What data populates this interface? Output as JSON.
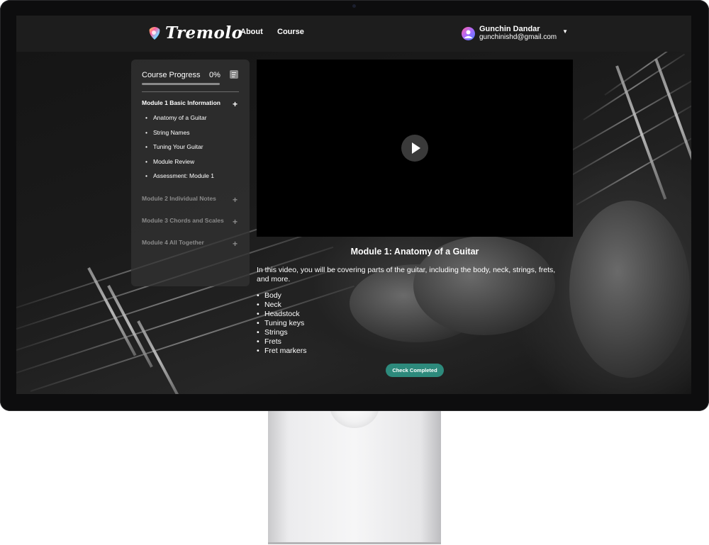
{
  "app": {
    "logo_text": "Tremolo",
    "nav": [
      "About",
      "Course"
    ]
  },
  "user": {
    "name": "Gunchin Dandar",
    "email": "gunchinishd@gmail.com"
  },
  "sidebar": {
    "progress_label": "Course Progress",
    "progress_value": "0%",
    "progress_fraction": 0,
    "modules": [
      {
        "title": "Module 1 Basic Information",
        "expanded": true,
        "lessons": [
          "Anatomy of a Guitar",
          "String Names",
          "Tuning Your Guitar",
          "Module Review",
          "Assessment: Module 1"
        ]
      },
      {
        "title": "Module 2 Individual Notes",
        "expanded": false
      },
      {
        "title": "Module 3 Chords and Scales",
        "expanded": false
      },
      {
        "title": "Module 4 All Together",
        "expanded": false
      }
    ]
  },
  "lesson": {
    "title": "Module 1: Anatomy of a Guitar",
    "description": "In this video, you will be covering parts of the guitar, including the body, neck, strings, frets, and more.",
    "parts": [
      "Body",
      "Neck",
      "Headstock",
      "Tuning keys",
      "Strings",
      "Frets",
      "Fret markers"
    ],
    "complete_button": "Check Completed"
  },
  "colors": {
    "accent": "#2d8a7c",
    "header_bg": "#1d1d1d",
    "sidebar_bg": "#323232"
  }
}
